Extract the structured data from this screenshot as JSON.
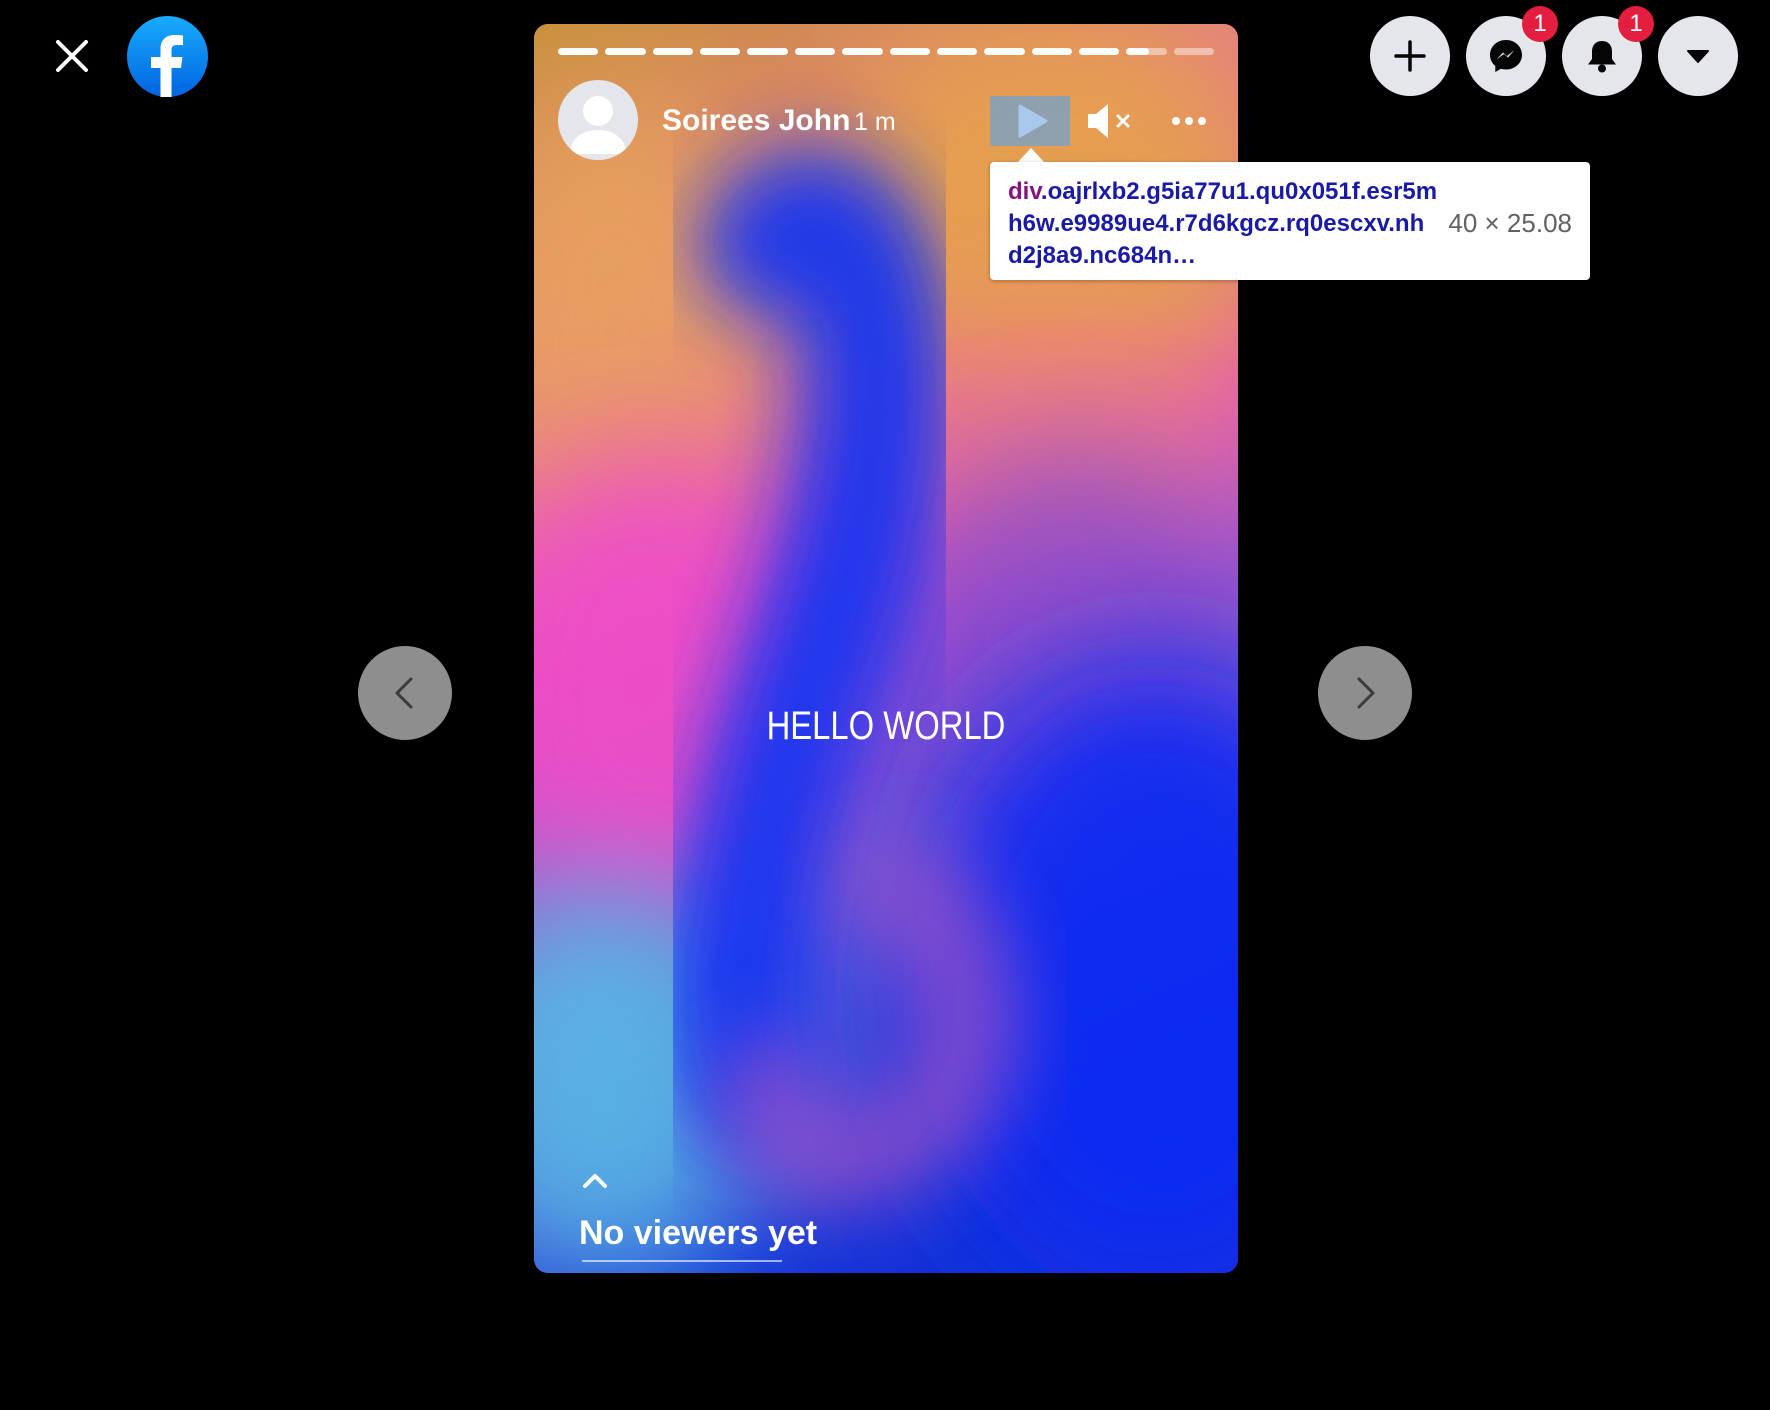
{
  "top_left": {
    "close_icon": "close-icon",
    "logo_icon": "facebook-logo-icon"
  },
  "top_right": {
    "create_icon": "plus-icon",
    "messenger_icon": "messenger-icon",
    "messenger_badge": "1",
    "notifications_icon": "bell-icon",
    "notifications_badge": "1",
    "account_icon": "caret-down-icon"
  },
  "story": {
    "author": "Soirees John",
    "time": "1 m",
    "text": "HELLO WORLD",
    "progress_segments": 14,
    "current_segment": 13,
    "current_segment_progress": 0.55,
    "viewers_label": "No viewers yet",
    "gradient_colors": [
      "#d9a24a",
      "#ec4fc8",
      "#1f3ff0",
      "#5ab6e6",
      "#0a2ce0"
    ]
  },
  "navigation": {
    "prev_icon": "chevron-left-icon",
    "next_icon": "chevron-right-icon"
  },
  "inspector_tooltip": {
    "tag": "div",
    "selector": ".oajrlxb2.g5ia77u1.qu0x051f.esr5mh6w.e9989ue4.r7d6kgcz.rq0escxv.nhd2j8a9.nc684n…",
    "size": "40 × 25.08"
  },
  "colors": {
    "badge_red": "#e41e3f",
    "facebook_blue": "#1877f2",
    "button_gray": "#e4e6eb",
    "selector_blue": "#1a1aa6",
    "tag_purple": "#881280"
  }
}
